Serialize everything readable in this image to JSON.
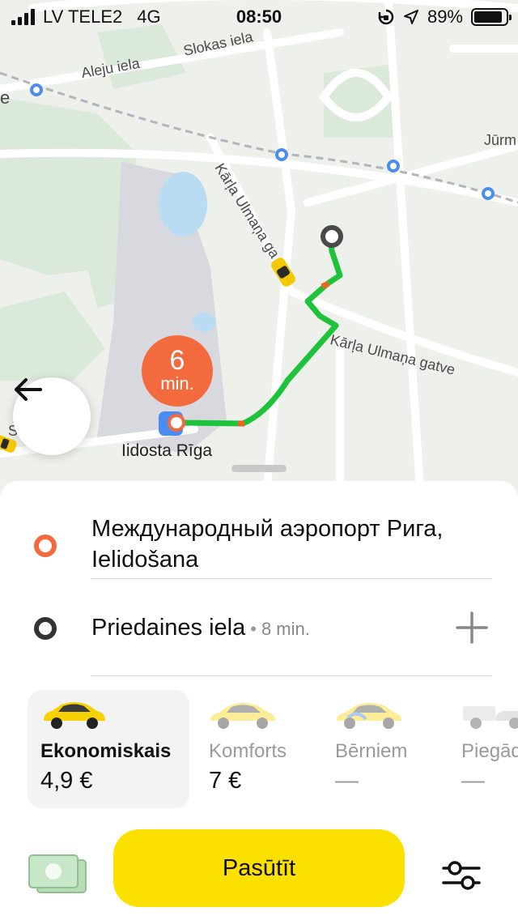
{
  "status_bar": {
    "carrier": "LV TELE2",
    "network": "4G",
    "time": "08:50",
    "battery": "89%",
    "battery_level": 0.89
  },
  "map": {
    "street_labels": [
      "Slokas iela",
      "Aleju iela",
      "Kārļa Ulmaņa ga",
      "Kārļa Ulmaņa gatve",
      "Jūrm",
      "e",
      "S"
    ],
    "place_label": "Iidosta Rīga",
    "eta": {
      "value": "6",
      "unit": "min."
    },
    "route_color": "#1fc33b"
  },
  "route": {
    "from": "Международный аэропорт Рига, Ielidošana",
    "to": "Priedaines iela",
    "separator": "•",
    "to_time": "8 min."
  },
  "tariffs": [
    {
      "name": "Ekonomiskais",
      "price": "4,9 €",
      "selected": true
    },
    {
      "name": "Komforts",
      "price": "7 €",
      "selected": false
    },
    {
      "name": "Bērniem",
      "price": "—",
      "selected": false
    },
    {
      "name": "Piegāde",
      "price": "—",
      "selected": false
    }
  ],
  "order_button": "Pasūtīt",
  "colors": {
    "accent": "#fce000",
    "origin": "#f26a3d",
    "route": "#1fc33b"
  },
  "icons": [
    "signal-icon",
    "rotation-lock-icon",
    "location-arrow-icon",
    "battery-icon",
    "back-arrow-icon",
    "plus-icon",
    "cash-icon",
    "settings-sliders-icon",
    "taxi-car-icon"
  ]
}
